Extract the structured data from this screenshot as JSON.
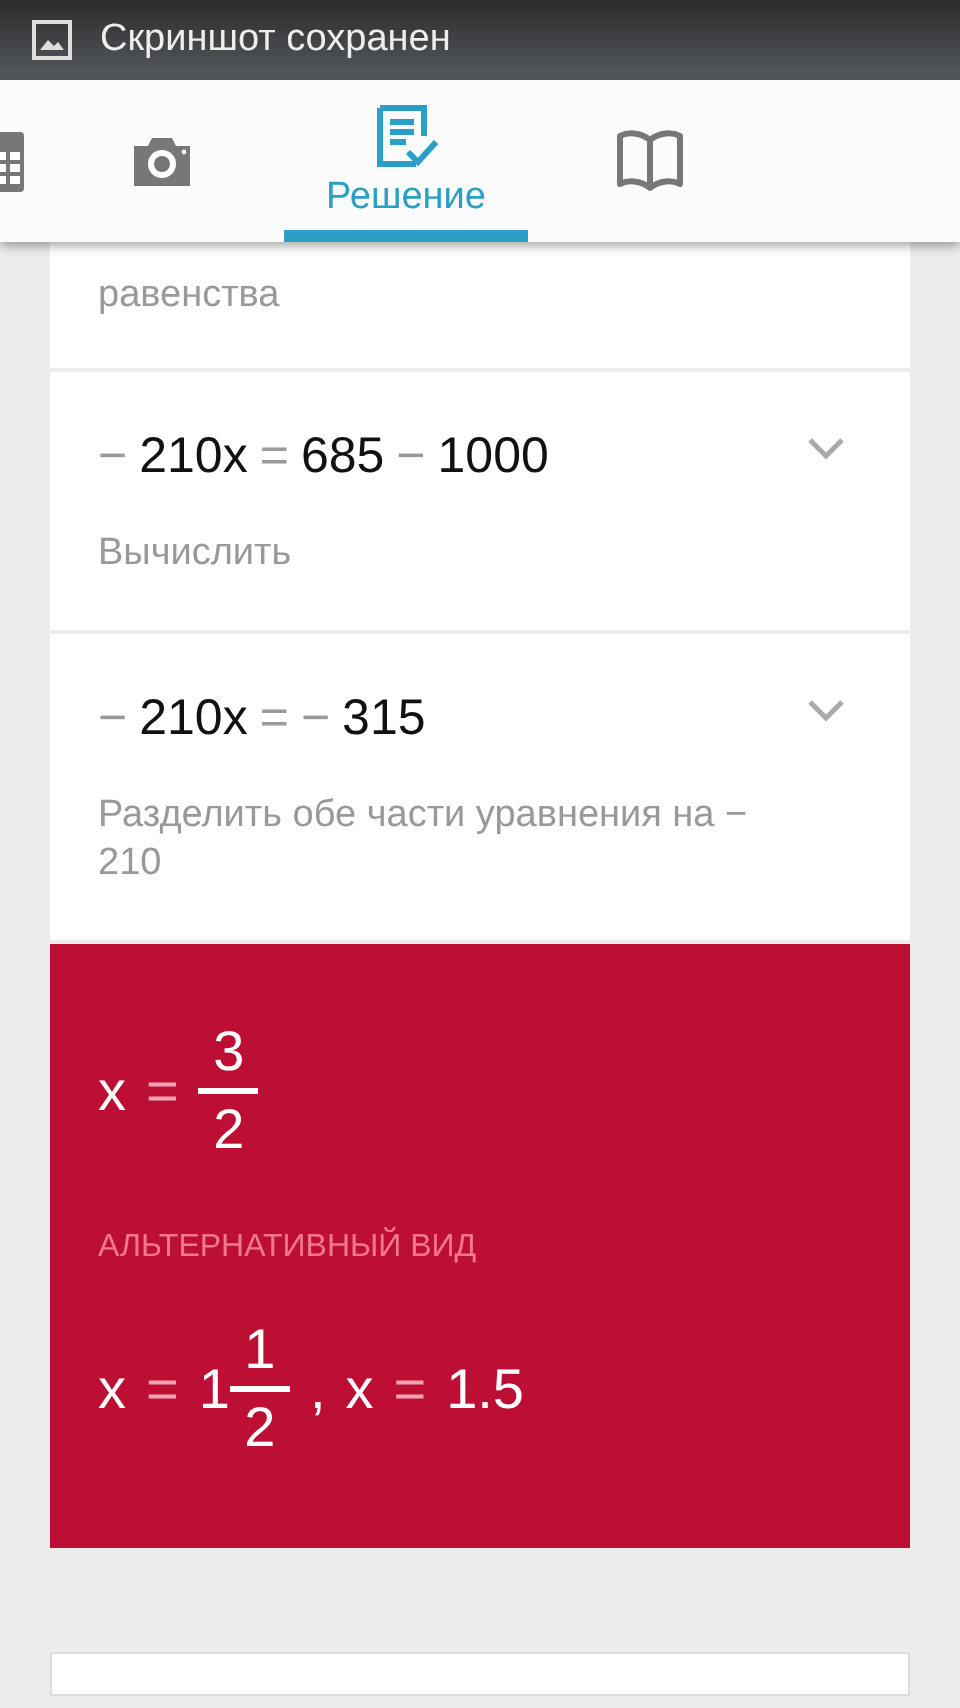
{
  "status_bar": {
    "notification": "Скриншот сохранен"
  },
  "tabs": [
    {
      "kind": "calculator",
      "selected": false
    },
    {
      "kind": "camera",
      "selected": false
    },
    {
      "kind": "solution",
      "label": "Решение",
      "selected": true
    },
    {
      "kind": "book",
      "selected": false
    }
  ],
  "steps": [
    {
      "description": "равенства"
    },
    {
      "equation": [
        {
          "kind": "op",
          "text": "−"
        },
        {
          "kind": "num",
          "text": "210x"
        },
        {
          "kind": "op",
          "text": "="
        },
        {
          "kind": "num",
          "text": "685"
        },
        {
          "kind": "op",
          "text": "−"
        },
        {
          "kind": "num",
          "text": "1000"
        }
      ],
      "expanded": false,
      "description": "Вычислить"
    },
    {
      "equation": [
        {
          "kind": "op",
          "text": "−"
        },
        {
          "kind": "num",
          "text": "210x"
        },
        {
          "kind": "op",
          "text": "="
        },
        {
          "kind": "op",
          "text": "−"
        },
        {
          "kind": "num",
          "text": "315"
        }
      ],
      "expanded": false,
      "description": "Разделить обе части уравнения на − 210"
    }
  ],
  "result": {
    "answer": [
      {
        "kind": "num",
        "text": "x"
      },
      {
        "kind": "op",
        "text": "="
      },
      {
        "kind": "frac",
        "numerator": "3",
        "denominator": "2"
      }
    ],
    "alternative_label": "АЛЬТЕРНАТИВНЫЙ ВИД",
    "alternative": [
      {
        "kind": "num",
        "text": "x"
      },
      {
        "kind": "op",
        "text": "="
      },
      {
        "kind": "num",
        "text": "1"
      },
      {
        "kind": "frac",
        "numerator": "1",
        "denominator": "2"
      },
      {
        "kind": "num",
        "text": ","
      },
      {
        "kind": "num",
        "text": "x"
      },
      {
        "kind": "op",
        "text": "="
      },
      {
        "kind": "num",
        "text": "1.5"
      }
    ]
  }
}
